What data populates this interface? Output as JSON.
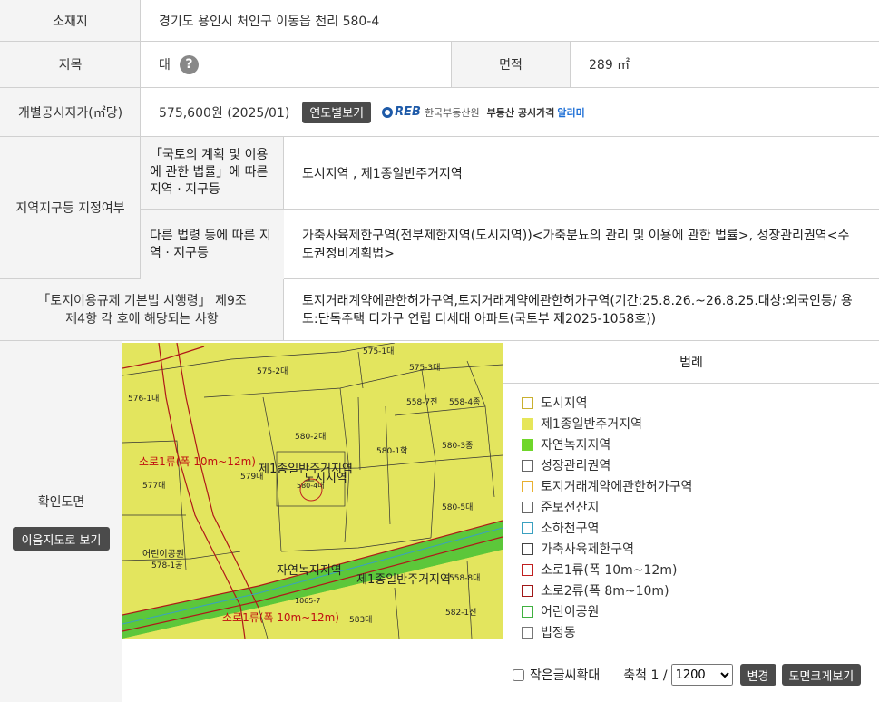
{
  "location": {
    "label": "소재지",
    "value": "경기도 용인시 처인구 이동읍 천리 580-4"
  },
  "land_category": {
    "label": "지목",
    "value": "대",
    "help_icon": "question-icon"
  },
  "area": {
    "label": "면적",
    "value": "289 ㎡"
  },
  "price": {
    "label": "개별공시지가(㎡당)",
    "value": "575,600원 (2025/01)",
    "button": "연도별보기",
    "logo_text": "REB",
    "logo_org": "한국부동산원",
    "logo_service_a": "부동산 공시가격",
    "logo_service_b": "알리미"
  },
  "zone": {
    "label": "지역지구등 지정여부",
    "sub1_label": "「국토의 계획 및 이용에 관한 법률」에 따른 지역 · 지구등",
    "sub1_value": "도시지역 , 제1종일반주거지역",
    "sub2_label": "다른 법령 등에 따른 지역 · 지구등",
    "sub2_value": "가축사육제한구역(전부제한지역(도시지역))<가축분뇨의 관리 및 이용에 관한 법률>, 성장관리권역<수도권정비계획법>"
  },
  "regulation": {
    "label": "「토지이용규제 기본법 시행령」 제9조 제4항 각 호에 해당되는 사항",
    "value": "토지거래계약에관한허가구역,토지거래계약에관한허가구역(기간:25.8.26.~26.8.25.대상:외국인등/ 용도:단독주택 다가구 연립 다세대 아파트(국토부 제2025-1058호))"
  },
  "map_section": {
    "label": "확인도면",
    "button": "이음지도로 보기"
  },
  "map": {
    "labels": [
      "575-2대",
      "575-1대",
      "575-3대",
      "558-7전",
      "558-4종",
      "576-1대",
      "580-2대",
      "580-1학",
      "580-3종",
      "580-5대",
      "579대",
      "577대",
      "580-4대",
      "제1종일반주거지역",
      "도시지역",
      "소로1류(폭 10m~12m)",
      "자연녹지지역",
      "어린이공원",
      "578-1공",
      "1065-7",
      "583대",
      "582-1전",
      "소로1류(폭 10m~12m)",
      "제1종일반주거지역",
      "558-8대"
    ]
  },
  "legend": {
    "title": "범례",
    "items": [
      {
        "label": "도시지역",
        "color": "#ffffff",
        "border": "#c9b030"
      },
      {
        "label": "제1종일반주거지역",
        "color": "#e6e65a",
        "border": "#e6e65a"
      },
      {
        "label": "자연녹지지역",
        "color": "#6fd62a",
        "border": "#6fd62a"
      },
      {
        "label": "성장관리권역",
        "color": "#ffffff",
        "border": "#666666"
      },
      {
        "label": "토지거래계약에관한허가구역",
        "color": "#ffffff",
        "border": "#e8b030"
      },
      {
        "label": "준보전산지",
        "color": "#ffffff",
        "border": "#666666"
      },
      {
        "label": "소하천구역",
        "color": "#ffffff",
        "border": "#3aa0c0"
      },
      {
        "label": "가축사육제한구역",
        "color": "#ffffff",
        "border": "#444444"
      },
      {
        "label": "소로1류(폭 10m~12m)",
        "color": "#ffffff",
        "border": "#c02020"
      },
      {
        "label": "소로2류(폭 8m~10m)",
        "color": "#ffffff",
        "border": "#a01818"
      },
      {
        "label": "어린이공원",
        "color": "#ffffff",
        "border": "#40b040"
      },
      {
        "label": "법정동",
        "color": "#ffffff",
        "border": "#777777"
      }
    ]
  },
  "footer": {
    "checkbox_label": "작은글씨확대",
    "scale_label": "축척 1 /",
    "scale_value": "1200",
    "change_button": "변경",
    "enlarge_button": "도면크게보기"
  }
}
